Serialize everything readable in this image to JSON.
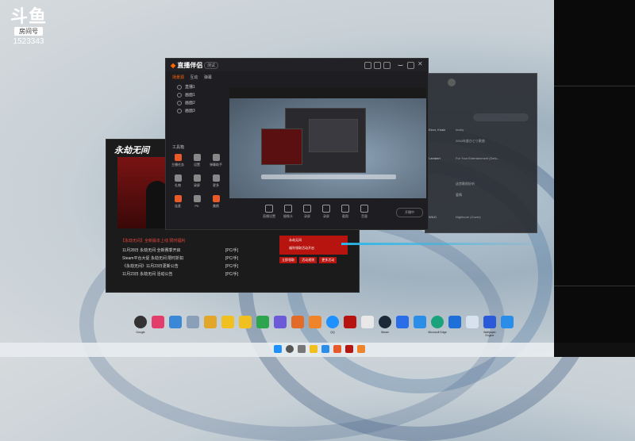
{
  "douyu": {
    "logo_mark": "斗鱼",
    "room_label": "房间号",
    "room_number": "1523343"
  },
  "main_window": {
    "app_name": "直播伴侣",
    "version_badge": "测试",
    "scene_tabs": [
      "场景源",
      "互动",
      "弹幕"
    ],
    "scenes": [
      "直播1",
      "画面1",
      "画面2",
      "画面3"
    ],
    "tools_title": "工具箱",
    "tools": [
      "主播任务",
      "设置",
      "弹幕助手",
      "礼物",
      "录屏",
      "更多",
      "连麦",
      "PK",
      "美颜",
      "小窗",
      "分屏",
      "设置"
    ],
    "controls": [
      "直播设置",
      "摄像头",
      "录屏",
      "录屏",
      "截图",
      "音量",
      "设置"
    ],
    "status_text": "开播中"
  },
  "music_window": {
    "rows": [
      [
        "Elect, Khaki",
        "lovely"
      ],
      [
        "",
        "2004年度ひとり歌曲"
      ],
      [
        "Lambert",
        "For Your Entertainment (Delu..."
      ],
      [
        "",
        ""
      ],
      [
        "",
        "这首歌很好听"
      ],
      [
        "",
        "爱情"
      ],
      [
        "",
        ""
      ],
      [
        "WILD",
        "Nightcore (Cover)"
      ]
    ]
  },
  "douyu_window": {
    "brand": "永劫无间",
    "list_title": "【永劫无间】全新版本上线 限时福利",
    "news": [
      {
        "title": "11月28日 永劫无间 全新赛季开启",
        "tag": "[PC/手]"
      },
      {
        "title": "Steam平台大促 永劫无间 限时折扣",
        "tag": "[PC/手]"
      },
      {
        "title": "《永劫无间》11月23日更新公告",
        "tag": "[PC/手]"
      },
      {
        "title": "11月23日 永劫无间 活动公告",
        "tag": "[PC/手]"
      }
    ],
    "card_text": "永劫无间",
    "card_sub": "福利领取活动开启",
    "buttons": [
      "立即领取",
      "活动规则",
      "更多活动"
    ]
  },
  "dock_labels": [
    "Google",
    "",
    "",
    "",
    "",
    "",
    "",
    "",
    "",
    "",
    "",
    "QQ",
    "",
    "",
    "Steam",
    "",
    "Microsoft Edge",
    "",
    "",
    "",
    "Wallpaper Engine",
    ""
  ],
  "colors": {
    "accent": "#e85a2a",
    "douyu_red": "#b8140f",
    "cyan": "#2bb7e8"
  }
}
